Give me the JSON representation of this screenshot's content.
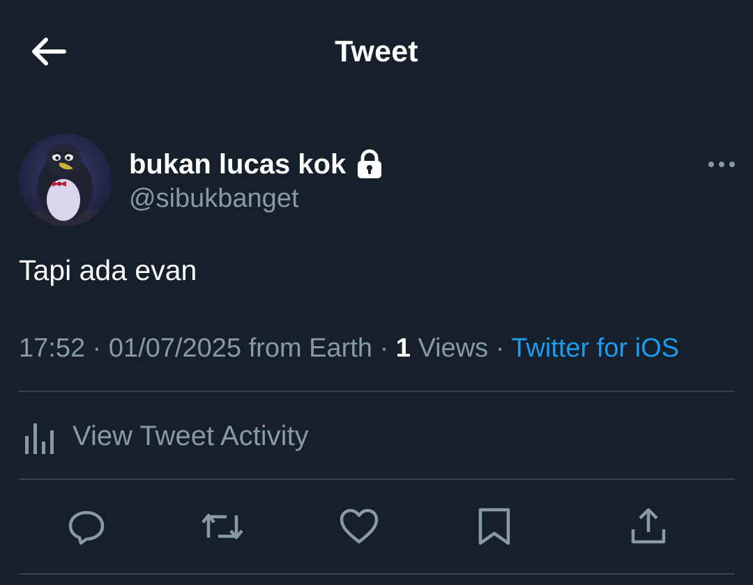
{
  "header": {
    "title": "Tweet",
    "back_icon": "back-arrow-icon"
  },
  "user": {
    "name": "bukan lucas kok",
    "handle": "@sibukbanget",
    "protected_icon": "lock-icon",
    "avatar": "penguin-avatar"
  },
  "more_icon": "more-options-icon",
  "tweet": {
    "text": "Tapi ada evan"
  },
  "meta": {
    "time": "17:52",
    "separator1": " · ",
    "date": "01/07/2025",
    "location": " from Earth",
    "separator2": " · ",
    "views_count": "1",
    "views_label": " Views",
    "separator3": " · ",
    "source": "Twitter for iOS"
  },
  "activity": {
    "label": "View Tweet Activity",
    "icon": "bar-chart-icon"
  },
  "actions": [
    "reply-icon",
    "retweet-icon",
    "like-icon",
    "bookmark-icon",
    "share-icon"
  ],
  "colors": {
    "background": "#15202b",
    "secondary_text": "#8b98a5",
    "link": "#1d9bf0",
    "divider": "#38444d"
  }
}
